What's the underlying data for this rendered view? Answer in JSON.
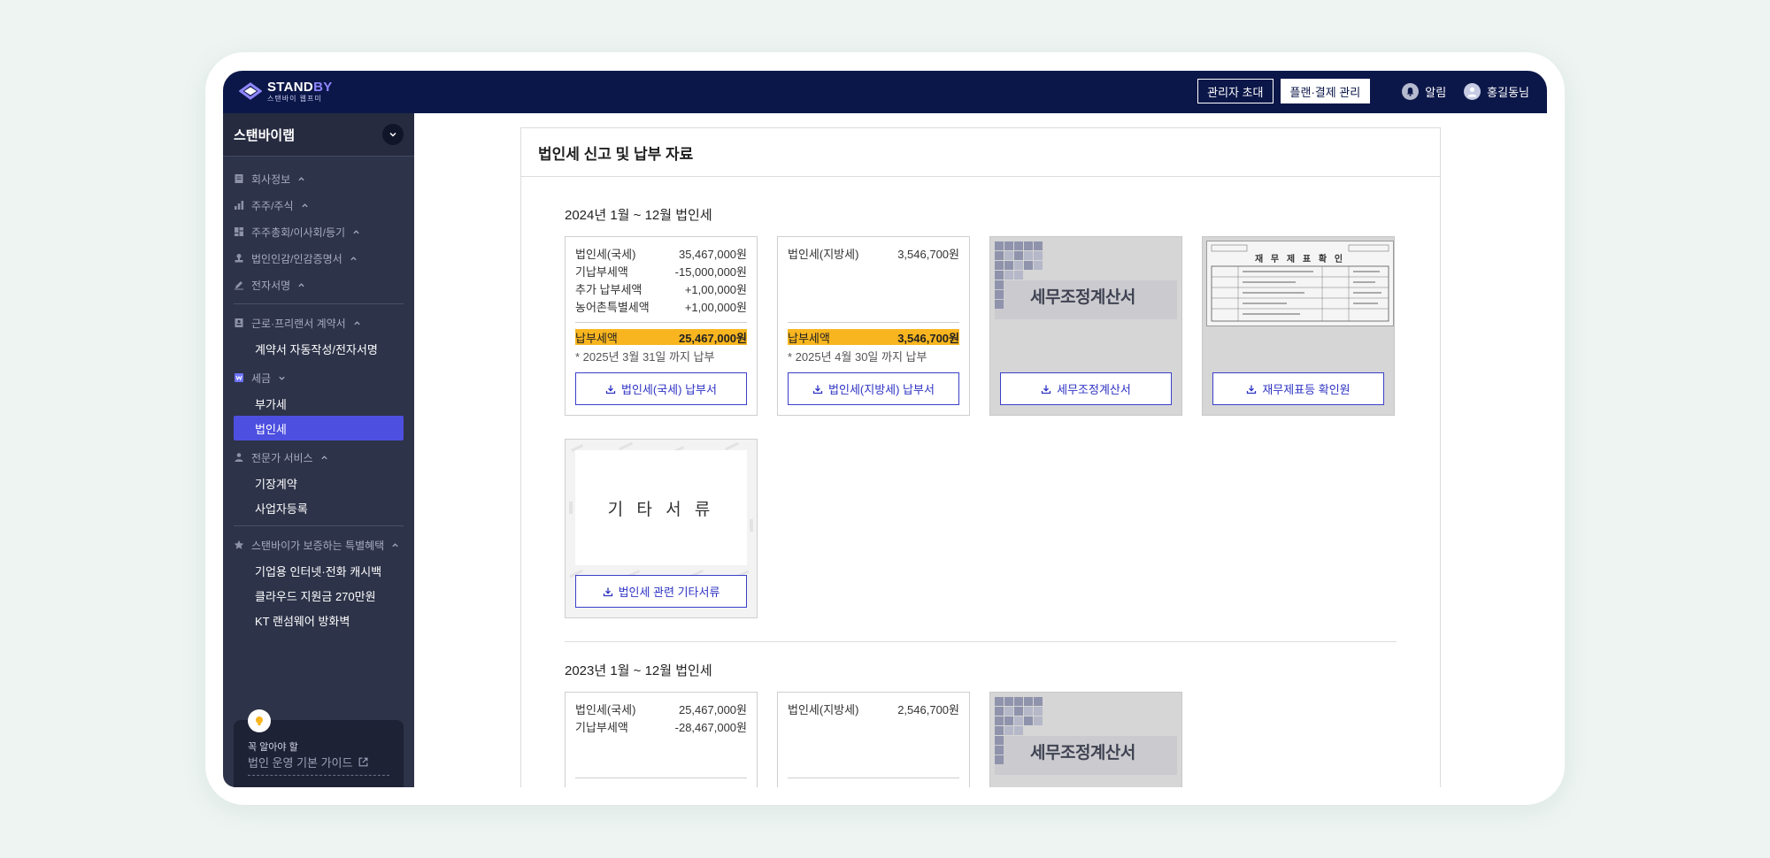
{
  "app": {
    "logo_main": "STAND",
    "logo_main_accent": "BY",
    "logo_sub": "스탠바이 웹프미"
  },
  "header": {
    "invite_admin": "관리자 초대",
    "plan_billing": "플랜·결제 관리",
    "notifications": "알림",
    "user": "홍길동님"
  },
  "sidebar": {
    "org": "스탠바이랩",
    "sections": {
      "company_info": "회사정보",
      "shareholders": "주주/주식",
      "meetings": "주주총회/이사회/등기",
      "seal": "법인인감/인감증명서",
      "esign": "전자서명",
      "contract": "근로·프리랜서 계약서",
      "contract_auto": "계약서 자동작성/전자서명",
      "tax": "세금",
      "vat": "부가세",
      "corp_tax": "법인세",
      "expert": "전문가 서비스",
      "bookkeeping": "기장계약",
      "biz_reg": "사업자등록",
      "benefits": "스탠바이가 보증하는 특별혜택",
      "cashback": "기업용 인터넷·전화 캐시백",
      "cloud": "클라우드 지원금 270만원",
      "kt": "KT 랜섬웨어 방화벽"
    },
    "tip": {
      "small": "꼭 알아야 할",
      "link": "법인 운영 기본 가이드"
    }
  },
  "main": {
    "panel_title": "법인세 신고 및 납부 자료",
    "y2024": {
      "title": "2024년 1월 ~ 12월 법인세",
      "national": {
        "rows": [
          {
            "label": "법인세(국세)",
            "value": "35,467,000원"
          },
          {
            "label": "기납부세액",
            "value": "-15,000,000원"
          },
          {
            "label": "추가 납부세액",
            "value": "+1,00,000원"
          },
          {
            "label": "농어촌특별세액",
            "value": "+1,00,000원"
          }
        ],
        "total_label": "납부세액",
        "total_value": "25,467,000원",
        "due": "* 2025년 3월 31일 까지 납부",
        "button": "법인세(국세) 납부서"
      },
      "local": {
        "rows": [
          {
            "label": "법인세(지방세)",
            "value": "3,546,700원"
          }
        ],
        "total_label": "납부세액",
        "total_value": "3,546,700원",
        "due": "* 2025년 4월 30일 까지 납부",
        "button": "법인세(지방세) 납부서"
      },
      "adjustment": {
        "thumb_title": "세무조정계산서",
        "button": "세무조정계산서"
      },
      "statements": {
        "thumb_title": "재 무 제 표 확 인",
        "button": "재무제표등 확인원"
      },
      "misc": {
        "thumb_title": "기 타 서 류",
        "button": "법인세 관련 기타서류"
      }
    },
    "y2023": {
      "title": "2023년 1월 ~ 12월 법인세",
      "national": {
        "rows": [
          {
            "label": "법인세(국세)",
            "value": "25,467,000원"
          },
          {
            "label": "기납부세액",
            "value": "-28,467,000원"
          }
        ]
      },
      "local": {
        "rows": [
          {
            "label": "법인세(지방세)",
            "value": "2,546,700원"
          }
        ]
      },
      "adjustment": {
        "thumb_title": "세무조정계산서"
      }
    }
  }
}
